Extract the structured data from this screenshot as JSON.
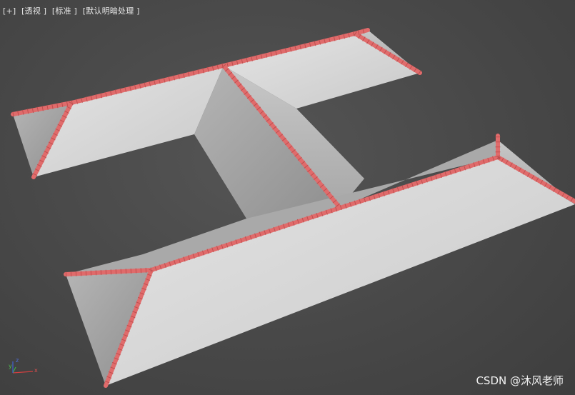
{
  "viewport": {
    "labels": {
      "maximize": "[+]",
      "view": "[透视 ]",
      "shading": "[标准 ]",
      "lighting": "[默认明暗处理 ]"
    },
    "background_color": "#474747"
  },
  "scene": {
    "surface_color": "#d9d9d9",
    "shadow_color": "#9a9a9a",
    "ridge_color": "#e06b6b"
  },
  "axis_gizmo": {
    "x": "x",
    "y": "y",
    "z": "z"
  },
  "watermark": "CSDN @沐风老师"
}
